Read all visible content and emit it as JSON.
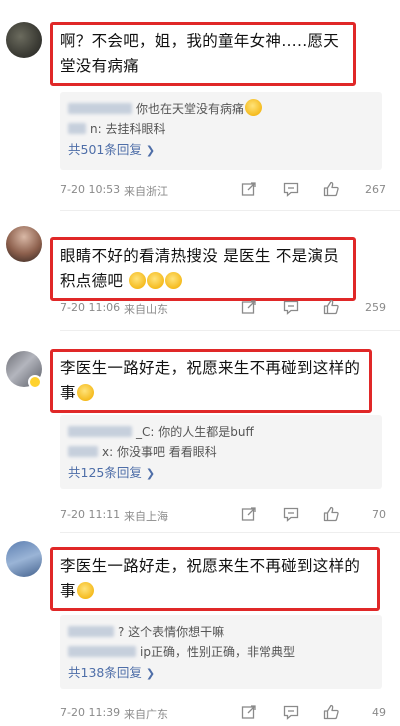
{
  "comments": [
    {
      "text": "啊？不会吧，姐，我的童年女神…..愿天堂没有病痛",
      "replies": [
        {
          "text": "你也在天堂没有病痛",
          "emoji": true
        },
        {
          "text": "n: 去挂科眼科"
        }
      ],
      "reply_count": "共501条回复",
      "time": "7-20 10:53",
      "location": "来自浙江",
      "likes": "267"
    },
    {
      "text": "眼睛不好的看清热搜没 是医生 不是演员 积点德吧",
      "replies": [],
      "reply_count": "",
      "time": "7-20 11:06",
      "location": "来自山东",
      "likes": "259"
    },
    {
      "text": "李医生一路好走，祝愿来生不再碰到这样的事",
      "replies": [
        {
          "text": "_C: 你的人生都是buff"
        },
        {
          "text": "x: 你没事吧 看看眼科"
        }
      ],
      "reply_count": "共125条回复",
      "time": "7-20 11:11",
      "location": "来自上海",
      "likes": "70"
    },
    {
      "text": "李医生一路好走，祝愿来生不再碰到这样的事",
      "replies": [
        {
          "text": "? 这个表情你想干嘛"
        },
        {
          "text": "ip正确，性别正确，非常典型"
        }
      ],
      "reply_count": "共138条回复",
      "time": "7-20 11:39",
      "location": "来自广东",
      "likes": "49"
    }
  ],
  "icons": {
    "share": "share-icon",
    "comment": "comment-icon",
    "like": "thumbs-up-icon",
    "chevron": "chevron-right-icon"
  },
  "colors": {
    "highlight_border": "#e02828",
    "link_blue": "#4e6ea8"
  }
}
